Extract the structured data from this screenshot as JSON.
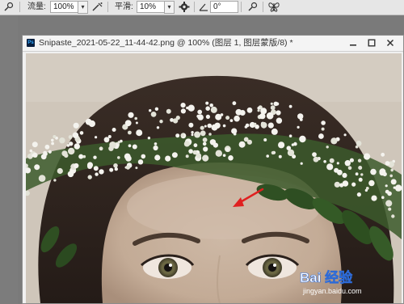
{
  "options_bar": {
    "flow_label": "流量:",
    "flow_value": "100%",
    "smooth_label": "平滑:",
    "smooth_value": "10%",
    "angle_value": "0°"
  },
  "document": {
    "title": "Snipaste_2021-05-22_11-44-42.png @ 100% (图层 1, 图层蒙版/8) *",
    "app_badge": "Ps"
  },
  "watermark": {
    "brand": "Bai 经验",
    "url": "jingyan.baidu.com"
  },
  "colors": {
    "annotation_arrow": "#e02020",
    "titlebar_bg": "#f4f4f4",
    "options_bg": "#e6e6e6"
  }
}
